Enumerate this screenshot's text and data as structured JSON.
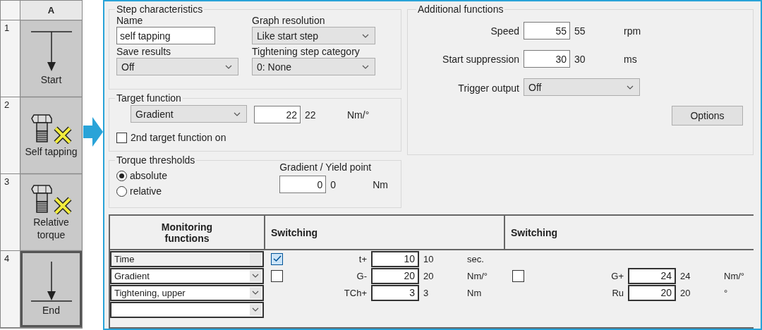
{
  "step_column": {
    "header": "A",
    "steps": [
      {
        "number": "1",
        "kind": "start",
        "label": "Start",
        "selected": false
      },
      {
        "number": "2",
        "kind": "screw",
        "label": "Self tapping",
        "selected": false
      },
      {
        "number": "3",
        "kind": "screw",
        "label": "Relative torque",
        "selected": false
      },
      {
        "number": "4",
        "kind": "end",
        "label": "End",
        "selected": true
      }
    ]
  },
  "step_characteristics": {
    "title": "Step characteristics",
    "name": {
      "label": "Name",
      "value": "self tapping"
    },
    "graph_resolution": {
      "label": "Graph resolution",
      "value": "Like start step"
    },
    "save_results": {
      "label": "Save results",
      "value": "Off"
    },
    "tightening_step_category": {
      "label": "Tightening step category",
      "value": "0: None"
    }
  },
  "target_function": {
    "title": "Target function",
    "function": "Gradient",
    "value": "22",
    "reading": "22",
    "unit": "Nm/°",
    "second_target": {
      "label": "2nd target function on",
      "checked": false
    }
  },
  "torque_thresholds": {
    "title": "Torque thresholds",
    "modes": [
      {
        "label": "absolute",
        "selected": true
      },
      {
        "label": "relative",
        "selected": false
      }
    ],
    "gradient_yield": {
      "label": "Gradient / Yield point",
      "value": "0",
      "reading": "0",
      "unit": "Nm"
    }
  },
  "additional_functions": {
    "title": "Additional functions",
    "speed": {
      "label": "Speed",
      "value": "55",
      "reading": "55",
      "unit": "rpm"
    },
    "start_suppression": {
      "label": "Start suppression",
      "value": "30",
      "reading": "30",
      "unit": "ms"
    },
    "trigger_output": {
      "label": "Trigger output",
      "value": "Off"
    },
    "options_button": "Options"
  },
  "monitoring": {
    "columns": [
      "Monitoring functions",
      "Switching",
      "Switching"
    ],
    "rows": [
      {
        "function": "Time",
        "disabled": true,
        "switching": [
          {
            "kind": "check-field",
            "checked": true,
            "label": "t+",
            "value": "10",
            "reading": "10",
            "unit": "sec."
          },
          {
            "kind": "empty"
          }
        ]
      },
      {
        "function": "Gradient",
        "disabled": false,
        "switching": [
          {
            "kind": "check-field",
            "checked": false,
            "label": "G-",
            "value": "20",
            "reading": "20",
            "unit": "Nm/°"
          },
          {
            "kind": "check-field",
            "checked": false,
            "label": "G+",
            "value": "24",
            "reading": "24",
            "unit": "Nm/°"
          }
        ]
      },
      {
        "function": "Tightening, upper",
        "disabled": false,
        "switching": [
          {
            "kind": "field",
            "label": "TCh+",
            "value": "3",
            "reading": "3",
            "unit": "Nm"
          },
          {
            "kind": "field",
            "label": "Ru",
            "value": "20",
            "reading": "20",
            "unit": "°"
          }
        ]
      },
      {
        "function": "",
        "disabled": false,
        "switching": [
          {
            "kind": "empty"
          },
          {
            "kind": "empty"
          }
        ]
      }
    ]
  }
}
